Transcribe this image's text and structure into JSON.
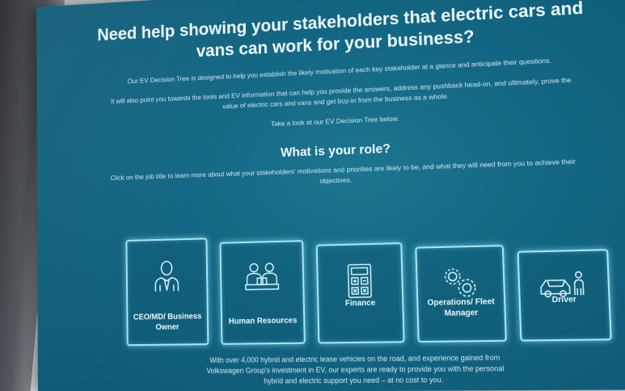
{
  "page": {
    "headline": "Need help showing your stakeholders that electric cars and vans can work for your business?",
    "intro_1": "Our EV Decision Tree is designed to help you establish the likely motivation of each key stakeholder at a glance and anticipate their questions.",
    "intro_2": "It will also point you towards the tools and EV information that can help you provide the answers, address any pushback head-on, and ultimately, prove the value of electric cars and vans and get buy-in from the business as a whole.",
    "intro_3": "Take a look at our EV Decision Tree below."
  },
  "roles": {
    "title": "What is your role?",
    "subtitle": "Click on the job title to learn more about what your stakeholders' motivations and priorities are likely to be, and what they will need from you to achieve their objectives.",
    "items": [
      {
        "label": "CEO/MD/ Business Owner",
        "icon": "person-tie-icon"
      },
      {
        "label": "Human Resources",
        "icon": "people-desk-icon"
      },
      {
        "label": "Finance",
        "icon": "calculator-icon"
      },
      {
        "label": "Operations/ Fleet Manager",
        "icon": "gears-icon"
      },
      {
        "label": "Driver",
        "icon": "car-person-icon"
      }
    ]
  },
  "footer": {
    "line_1": "With over 4,000 hybrid and electric lease vehicles on the road, and experience gained from",
    "line_2": "Volkswagen Group's investment in EV, our experts are ready to provide you with the personal",
    "line_3": "hybrid and electric support you need – at no cost to you."
  },
  "colors": {
    "background": "#136683",
    "card_border": "#a9e4f2",
    "text": "#eef8fb"
  }
}
